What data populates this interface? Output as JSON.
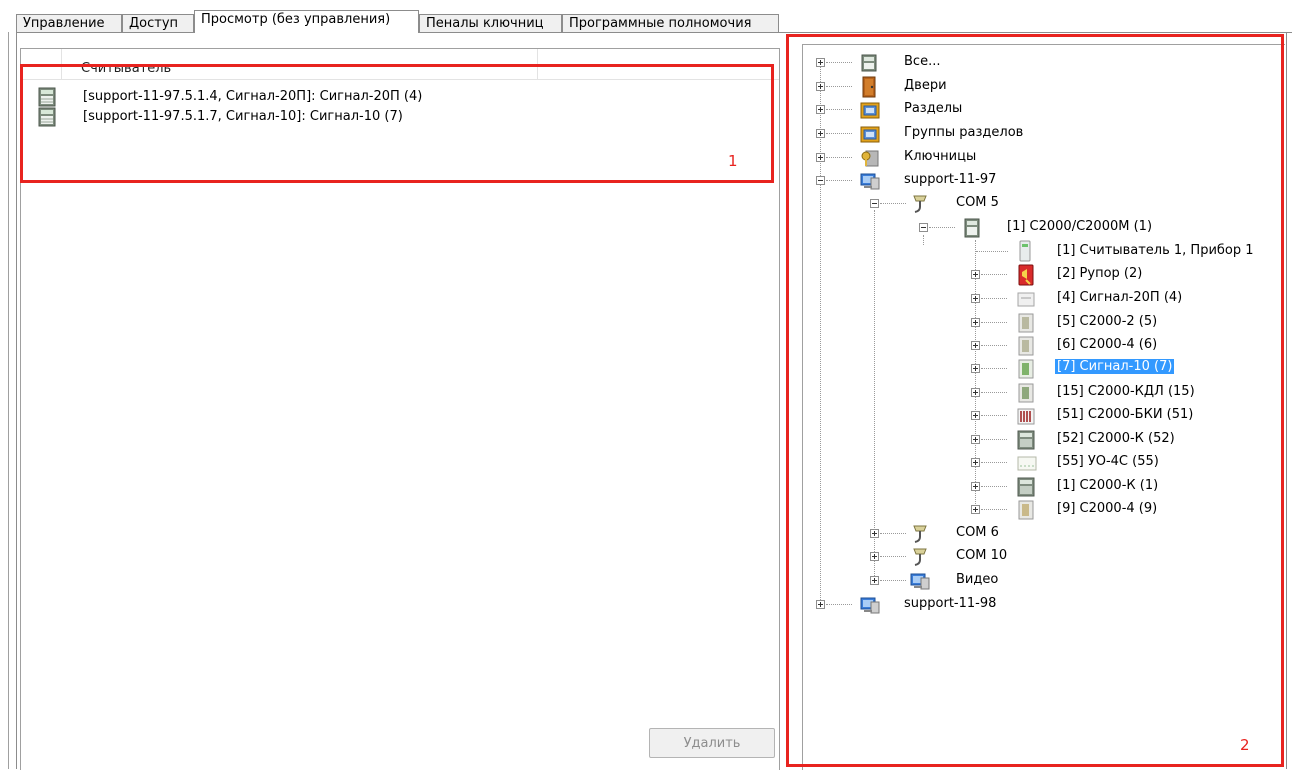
{
  "tabs": [
    {
      "label": "Управление"
    },
    {
      "label": "Доступ"
    },
    {
      "label": "Просмотр (без управления)"
    },
    {
      "label": "Пеналы ключниц"
    },
    {
      "label": "Программные полномочия"
    }
  ],
  "left": {
    "column_header": "Считыватель",
    "rows": [
      {
        "label": "[support-11-97.5.1.4, Сигнал-20П]: Сигнал-20П (4)"
      },
      {
        "label": "[support-11-97.5.1.7, Сигнал-10]: Сигнал-10 (7)"
      }
    ],
    "annotation": "1",
    "delete_button": "Удалить"
  },
  "tree": {
    "annotation": "2",
    "nodes": [
      {
        "label": "Все...",
        "icon": "server-icon"
      },
      {
        "label": "Двери",
        "icon": "door-icon"
      },
      {
        "label": "Разделы",
        "icon": "sections-icon"
      },
      {
        "label": "Группы разделов",
        "icon": "section-groups-icon"
      },
      {
        "label": "Ключницы",
        "icon": "keybox-icon"
      },
      {
        "label": "support-11-97",
        "icon": "computer-icon"
      },
      {
        "label": "COM 5",
        "icon": "com-port-icon"
      },
      {
        "label": "[1] С2000/С2000М (1)",
        "icon": "controller-icon"
      },
      {
        "label": "[1] Считыватель 1, Прибор 1",
        "icon": "reader-icon"
      },
      {
        "label": "[2] Рупор (2)",
        "icon": "horn-icon"
      },
      {
        "label": "[4] Сигнал-20П (4)",
        "icon": "signal20p-icon"
      },
      {
        "label": "[5] С2000-2 (5)",
        "icon": "module-icon"
      },
      {
        "label": "[6] С2000-4 (6)",
        "icon": "module-icon"
      },
      {
        "label": "[7] Сигнал-10 (7)",
        "icon": "module-green-icon",
        "selected": true
      },
      {
        "label": "[15] С2000-КДЛ (15)",
        "icon": "module-icon"
      },
      {
        "label": "[51] С2000-БКИ (51)",
        "icon": "indicator-icon"
      },
      {
        "label": "[52] С2000-К (52)",
        "icon": "keypad-icon"
      },
      {
        "label": "[55] УО-4С (55)",
        "icon": "modem-icon"
      },
      {
        "label": "[1] С2000-К (1)",
        "icon": "keypad-icon"
      },
      {
        "label": "[9] С2000-4 (9)",
        "icon": "module-icon"
      },
      {
        "label": "COM 6",
        "icon": "com-port-icon"
      },
      {
        "label": "COM 10",
        "icon": "com-port-icon"
      },
      {
        "label": "Видео",
        "icon": "video-icon"
      },
      {
        "label": "support-11-98",
        "icon": "computer-icon"
      }
    ]
  },
  "colors": {
    "annotation": "#e8231f",
    "selection": "#3399ff"
  }
}
